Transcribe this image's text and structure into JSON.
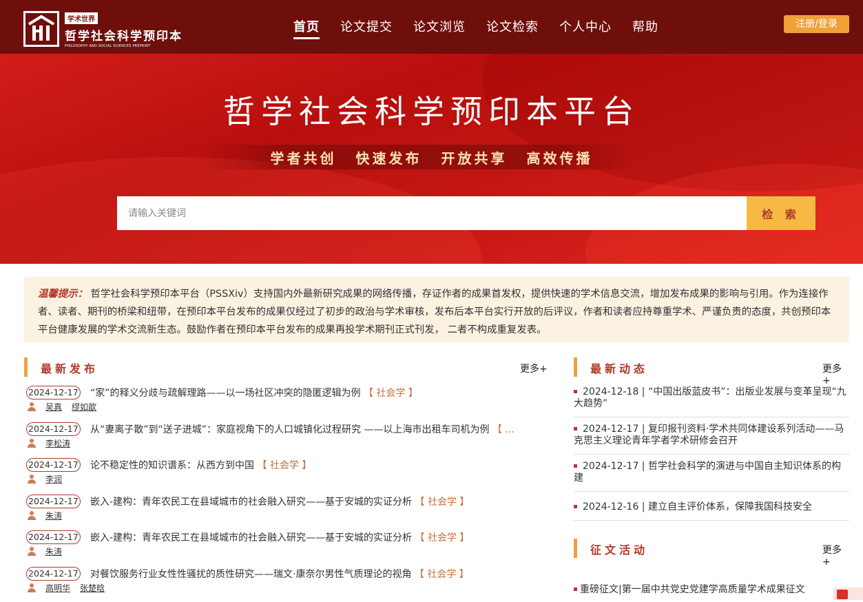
{
  "header": {
    "logo_badge": "学术世界",
    "logo_cn": "哲学社会科学预印本",
    "logo_en": "PHILOSOPHY AND SOCIAL SCIENCES PREPRINT",
    "nav": [
      {
        "label": "首页",
        "active": true
      },
      {
        "label": "论文提交",
        "active": false
      },
      {
        "label": "论文浏览",
        "active": false
      },
      {
        "label": "论文检索",
        "active": false
      },
      {
        "label": "个人中心",
        "active": false
      },
      {
        "label": "帮助",
        "active": false
      }
    ],
    "login_label": "注册/登录"
  },
  "banner": {
    "title": "哲学社会科学预印本平台",
    "slogans": [
      "学者共创",
      "快速发布",
      "开放共享",
      "高效传播"
    ]
  },
  "search": {
    "placeholder": "请输入关键词",
    "button_label": "检 索"
  },
  "notice": {
    "label": "温馨提示：",
    "text": "哲学社会科学预印本平台（PSSXiv）支持国内外最新研究成果的网络传播，存证作者的成果首发权，提供快速的学术信息交流，增加发布成果的影响与引用。作为连接作者、读者、期刊的桥梁和纽带，在预印本平台发布的成果仅经过了初步的政治与学术审核，发布后本平台实行开放的后评议，作者和读者应持尊重学术、严谨负责的态度，共创预印本平台健康发展的学术交流新生态。鼓励作者在预印本平台发布的成果再投学术期刊正式刊发， 二者不构成重复发表。"
  },
  "latest": {
    "title": "最新发布",
    "more": "更多+",
    "items": [
      {
        "date": "2024-12-17",
        "title": "“家”的释义分歧与疏解理路——以一场社区冲突的隐匿逻辑为例",
        "tag": "【 社会学 】",
        "authors": [
          "吴真",
          "缪如歆"
        ]
      },
      {
        "date": "2024-12-17",
        "title": "从“妻离子散”到“送子进城”：家庭视角下的人口城镇化过程研究 ——以上海市出租车司机为例",
        "tag": "【 ...",
        "authors": [
          "李松涛"
        ]
      },
      {
        "date": "2024-12-17",
        "title": "论不稳定性的知识谱系：从西方到中国",
        "tag": "【 社会学 】",
        "authors": [
          "李润"
        ]
      },
      {
        "date": "2024-12-17",
        "title": "嵌入-建构：青年农民工在县域城市的社会融入研究——基于安城的实证分析",
        "tag": "【 社会学 】",
        "authors": [
          "朱涛"
        ]
      },
      {
        "date": "2024-12-17",
        "title": "嵌入-建构：青年农民工在县域城市的社会融入研究——基于安城的实证分析",
        "tag": "【 社会学 】",
        "authors": [
          "朱涛"
        ]
      },
      {
        "date": "2024-12-17",
        "title": "对餐饮服务行业女性性骚扰的质性研究——瑞文·康奈尔男性气质理论的视角",
        "tag": "【 社会学 】",
        "authors": [
          "高明华",
          "张楚晗"
        ]
      }
    ]
  },
  "news": {
    "title": "最新动态",
    "more": "更多+",
    "items": [
      {
        "text": "2024-12-18 | “中国出版蓝皮书”：出版业发展与变革呈现“九大趋势”"
      },
      {
        "text": "2024-12-17 | 复印报刊资料·学术共同体建设系列活动——马克思主义理论青年学者学术研修会召开"
      },
      {
        "text": "2024-12-17 | 哲学社会科学的演进与中国自主知识体系的构建"
      },
      {
        "text": "2024-12-16 | 建立自主评价体系，保障我国科技安全"
      }
    ]
  },
  "events": {
    "title": "征文活动",
    "more": "更多+",
    "items": [
      {
        "text": "重磅征文|第一届中共党史党建学高质量学术成果征文"
      }
    ]
  },
  "colors": {
    "header_bg": "#6e0f0c",
    "banner_red": "#c41713",
    "accent_orange": "#f0a13a",
    "title_red": "#b0392a",
    "notice_bg": "#fbf2e2"
  }
}
